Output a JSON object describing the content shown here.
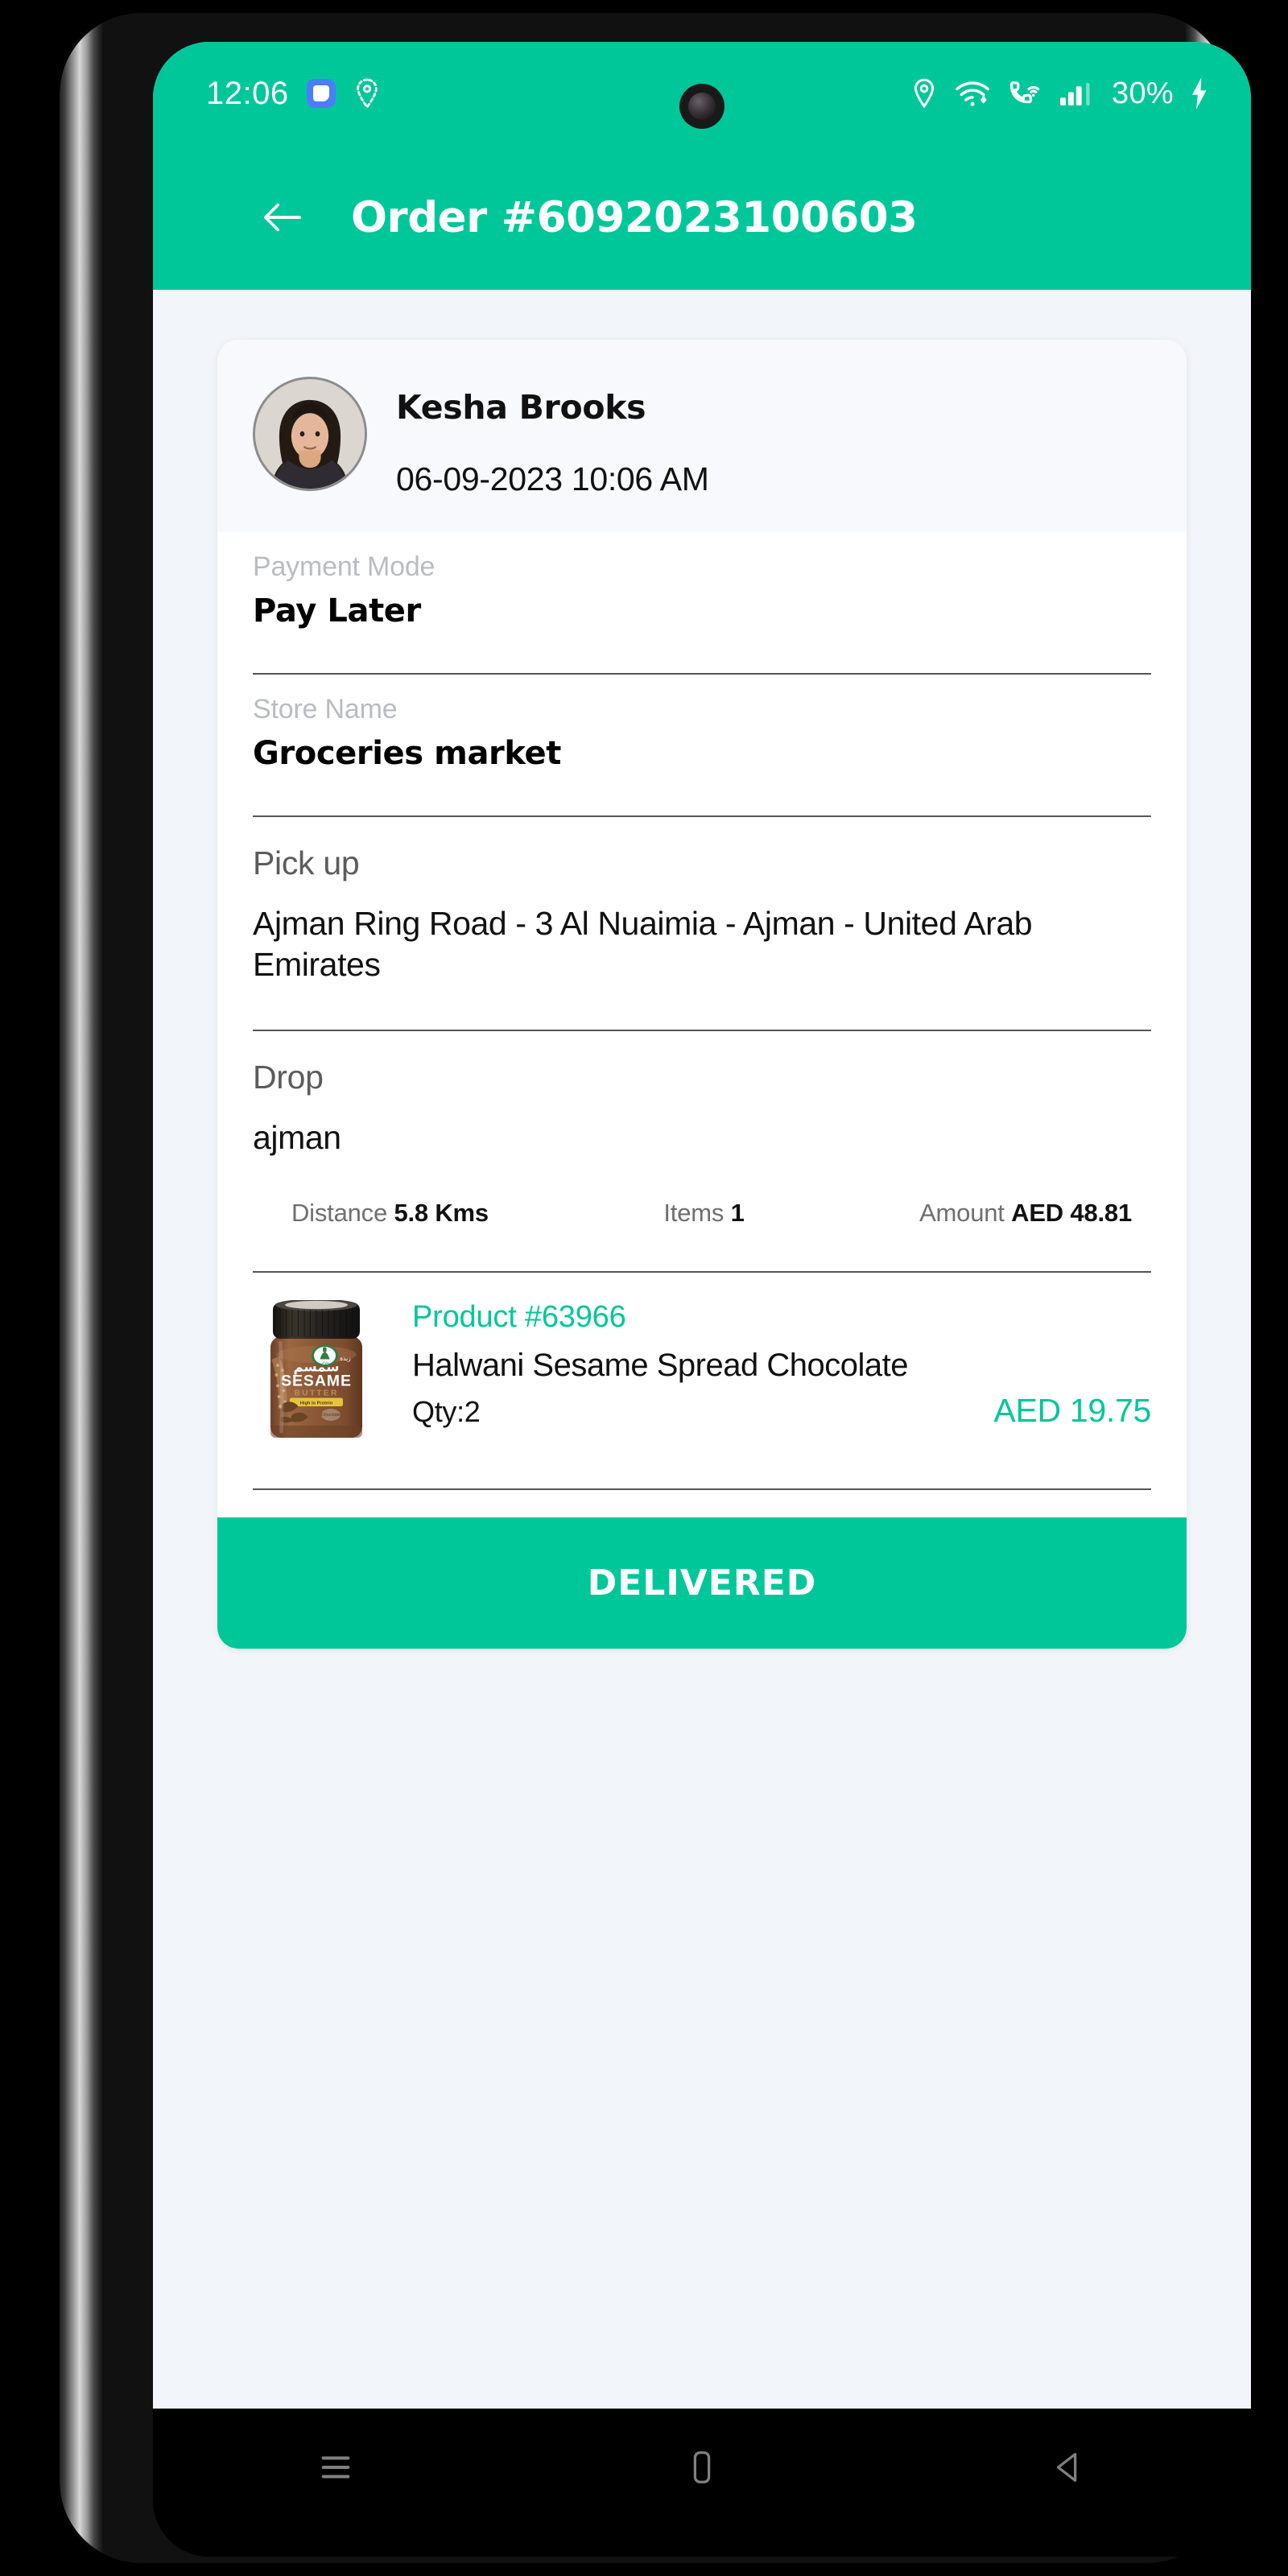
{
  "theme": {
    "accent": "#00C79A",
    "screen_bg": "#F2F5F9",
    "card_bg": "#FFFFFF",
    "muted_text": "#B9BCC2",
    "divider": "#555555"
  },
  "status_bar": {
    "time": "12:06",
    "battery_percent": "30%",
    "left_icons": [
      "app-notification-icon",
      "location-dashed-icon"
    ],
    "right_icons": [
      "location-pin-icon",
      "wifi-icon",
      "vowifi-call-icon",
      "signal-bars-icon",
      "charging-bolt-icon"
    ]
  },
  "app_bar": {
    "back_label": "back-arrow",
    "title": "Order #6092023100603"
  },
  "customer": {
    "name": "Kesha  Brooks",
    "datetime": "06-09-2023 10:06 AM",
    "avatar_alt": "customer-avatar"
  },
  "details": [
    {
      "label": "Payment Mode",
      "value": "Pay Later",
      "style": "small-label-bold-value"
    },
    {
      "label": "Store Name",
      "value": "Groceries market",
      "style": "small-label-bold-value"
    },
    {
      "label": "Pick up",
      "value": "Ajman Ring Road - 3 Al Nuaimia - Ajman - United Arab Emirates",
      "style": "medium-label-regular-value"
    },
    {
      "label": "Drop",
      "value": "ajman",
      "style": "medium-label-regular-value"
    }
  ],
  "stats": [
    {
      "label": "Distance",
      "value": "5.8 Kms"
    },
    {
      "label": "Items",
      "value": "1"
    },
    {
      "label": "Amount",
      "value": "AED 48.81"
    }
  ],
  "product": {
    "id": "Product #63966",
    "name": "Halwani Sesame Spread Chocolate",
    "qty": "Qty:2",
    "price": "AED 19.75",
    "image_alt": "sesame-butter-jar"
  },
  "action_button": {
    "label": "DELIVERED"
  },
  "nav_bar": {
    "items": [
      "recents-icon",
      "home-icon",
      "back-icon"
    ]
  }
}
